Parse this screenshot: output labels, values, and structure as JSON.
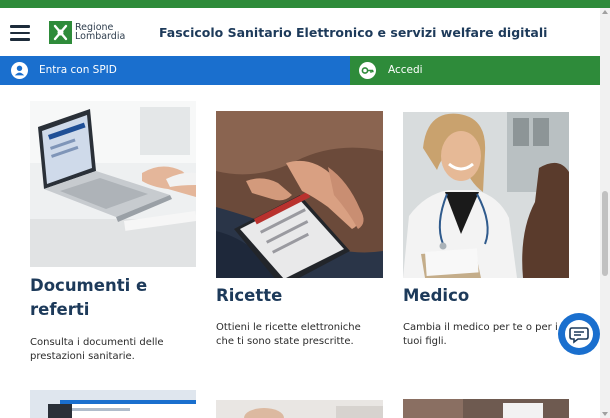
{
  "header": {
    "logo_line1": "Regione",
    "logo_line2": "Lombardia",
    "title": "Fascicolo Sanitario Elettronico e servizi welfare digitali"
  },
  "login_bar": {
    "spid_label": "Entra con SPID",
    "accedi_label": "Accedi"
  },
  "cards": [
    {
      "title_line1": "Documenti e",
      "title_line2": "referti",
      "desc_line1": "Consulta i documenti delle",
      "desc_line2": "prestazioni sanitarie."
    },
    {
      "title_line1": "Ricette",
      "desc_line1": "Ottieni le ricette elettroniche",
      "desc_line2": "che ti sono state prescritte."
    },
    {
      "title_line1": "Medico",
      "desc_line1": "Cambia il medico per te o per i",
      "desc_line2": "tuoi figli."
    }
  ],
  "icons": {
    "menu": "hamburger-menu-icon",
    "logo": "regione-lombardia-logo",
    "spid": "user-icon",
    "accedi": "key-icon",
    "chat": "chat-bubble-icon"
  },
  "colors": {
    "brand_green": "#2e8b3a",
    "spid_blue": "#1a6fce",
    "title_navy": "#1d3a5a"
  }
}
